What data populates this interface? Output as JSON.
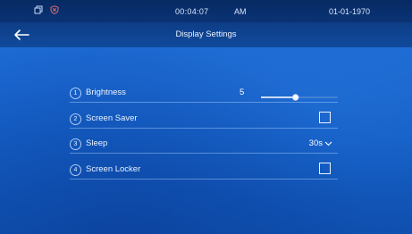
{
  "status_bar": {
    "time": "00:04:07",
    "ampm": "AM",
    "date": "01-01-1970",
    "icons": [
      "copy-icon",
      "shield-x-icon"
    ]
  },
  "header": {
    "title": "Display Settings",
    "back_icon": "back-arrow-icon"
  },
  "settings": [
    {
      "number": "1",
      "label": "Brightness",
      "value": "5",
      "control": "slider",
      "level": 0.45
    },
    {
      "number": "2",
      "label": "Screen Saver",
      "control": "checkbox",
      "checked": false
    },
    {
      "number": "3",
      "label": "Sleep",
      "value": "30s",
      "control": "dropdown"
    },
    {
      "number": "4",
      "label": "Screen Locker",
      "control": "checkbox",
      "checked": false
    }
  ],
  "colors": {
    "background": "#1a66cf",
    "status_bar": "#072a63",
    "title_bar": "#0d3d86",
    "text": "#eaf3ff",
    "slider_fill": "#ffffff",
    "slider_track": "#5b8fd6"
  }
}
